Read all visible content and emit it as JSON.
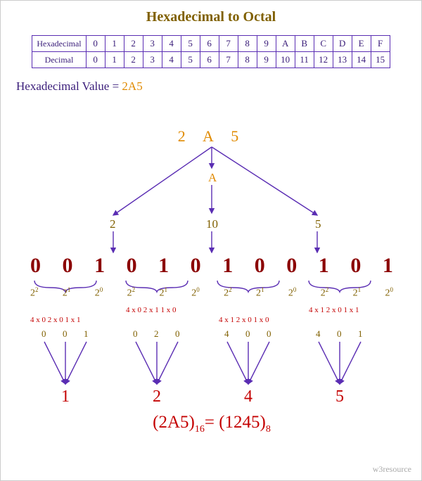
{
  "title": "Hexadecimal to Octal",
  "table": {
    "rowHexLabel": "Hexadecimal",
    "rowDecLabel": "Decimal",
    "hex": [
      "0",
      "1",
      "2",
      "3",
      "4",
      "5",
      "6",
      "7",
      "8",
      "9",
      "A",
      "B",
      "C",
      "D",
      "E",
      "F"
    ],
    "dec": [
      "0",
      "1",
      "2",
      "3",
      "4",
      "5",
      "6",
      "7",
      "8",
      "9",
      "10",
      "11",
      "12",
      "13",
      "14",
      "15"
    ]
  },
  "hvLabel": "Hexadecimal Value  = ",
  "hvValue": "2A5",
  "topHex": "2 A 5",
  "midNode": "A",
  "three": {
    "left": "2",
    "mid": "10",
    "right": "5"
  },
  "binary": [
    "0",
    "0",
    "1",
    "0",
    "1",
    "0",
    "1",
    "0",
    "0",
    "1",
    "0",
    "1"
  ],
  "powers": [
    "2",
    "1",
    "0",
    "2",
    "1",
    "0",
    "2",
    "1",
    "0",
    "2",
    "1",
    "0"
  ],
  "adds": {
    "g1": "4 x 0 2 x 0 1 x 1",
    "g2": "4 x 0 2 x 1 1 x 0",
    "g3": "4 x 1 2 x 0 1 x 0",
    "g4": "4 x 1 2 x 0 1 x 1"
  },
  "triples": {
    "g1": [
      "0",
      "0",
      "1"
    ],
    "g2": [
      "0",
      "2",
      "0"
    ],
    "g3": [
      "4",
      "0",
      "0"
    ],
    "g4": [
      "4",
      "0",
      "1"
    ]
  },
  "octal": [
    "1",
    "2",
    "4",
    "5"
  ],
  "equation": {
    "lhs": "2A5",
    "lhsBase": "16",
    "rhs": "1245",
    "rhsBase": "8",
    "eq": "="
  },
  "watermark": "w3resource",
  "conversion": {
    "input_hex": "2A5",
    "binary_12bit": "001010100101",
    "octal_groups_values": [
      1,
      2,
      4,
      5
    ],
    "output_octal": "1245"
  }
}
